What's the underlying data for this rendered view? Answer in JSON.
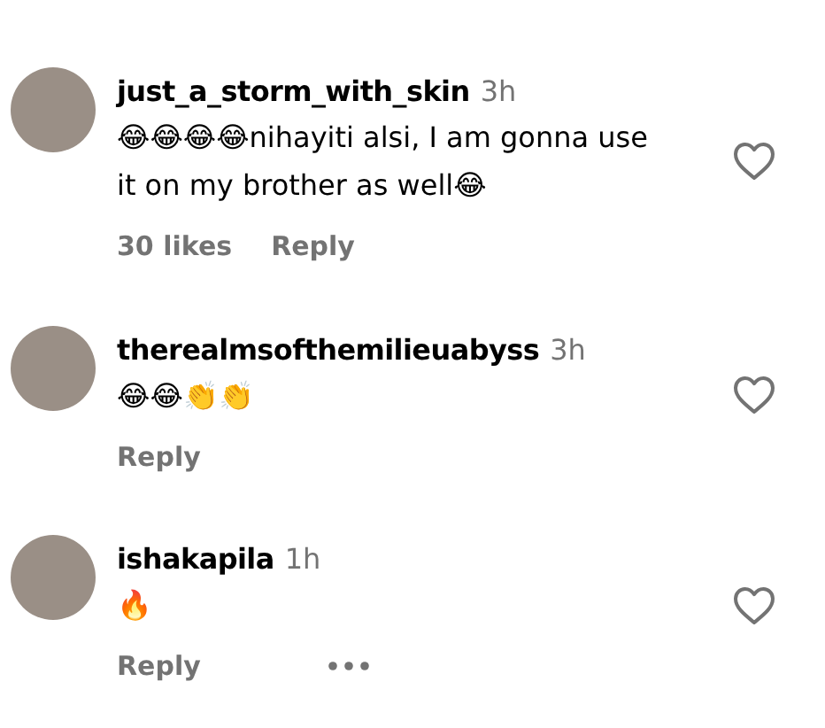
{
  "comments": [
    {
      "username": "just_a_storm_with_skin",
      "time": "3h",
      "text": "😂😂😂😂nihayiti alsi, I am gonna use it on my brother as well😂",
      "likes": "30 likes",
      "reply": "Reply",
      "liked": false,
      "more": false
    },
    {
      "username": "therealmsofthemilieuabyss",
      "time": "3h",
      "text": "😂😂👏👏",
      "reply": "Reply",
      "liked": false,
      "more": false
    },
    {
      "username": "ishakapila",
      "time": "1h",
      "text": "🔥",
      "reply": "Reply",
      "liked": false,
      "more": true
    }
  ]
}
